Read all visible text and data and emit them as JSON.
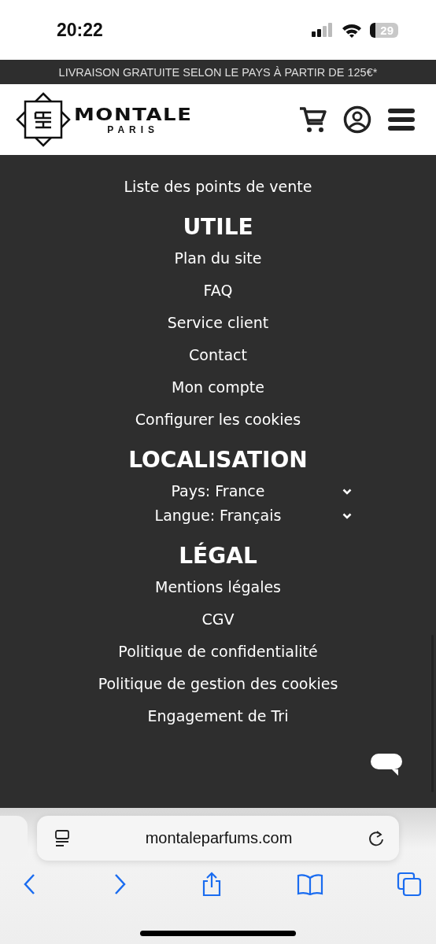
{
  "status_bar": {
    "time": "20:22",
    "battery": "29"
  },
  "banner": {
    "text": "LIVRAISON GRATUITE SELON LE PAYS À PARTIR DE 125€*"
  },
  "header": {
    "logo_name": "MONTALE",
    "logo_sub": "PARIS"
  },
  "footer": {
    "top_links": [
      "Liste des points de vente"
    ],
    "sections": [
      {
        "title": "UTILE",
        "kind": "links",
        "items": [
          "Plan du site",
          "FAQ",
          "Service client",
          "Contact",
          "Mon compte",
          "Configurer les cookies"
        ]
      },
      {
        "title": "LOCALISATION",
        "kind": "selects",
        "items": [
          "Pays: France",
          "Langue: Français"
        ]
      },
      {
        "title": "LÉGAL",
        "kind": "links",
        "items": [
          "Mentions légales",
          "CGV",
          "Politique de confidentialité",
          "Politique de gestion des cookies",
          "Engagement de Tri"
        ]
      }
    ]
  },
  "browser": {
    "url": "montaleparfums.com"
  }
}
